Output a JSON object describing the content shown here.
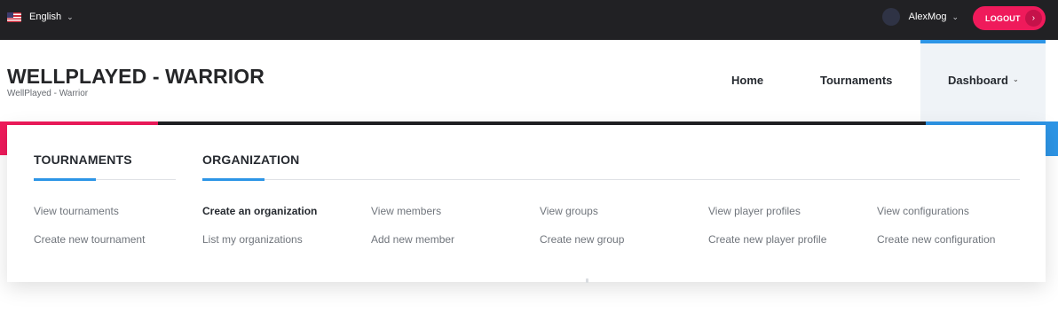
{
  "topbar": {
    "language": "English",
    "username": "AlexMog",
    "logout_label": "LOGOUT"
  },
  "header": {
    "title": "WELLPLAYED - WARRIOR",
    "subtitle": "WellPlayed - Warrior",
    "nav": {
      "home": "Home",
      "tournaments": "Tournaments",
      "dashboard": "Dashboard"
    }
  },
  "mega_menu": {
    "tournaments": {
      "title": "TOURNAMENTS",
      "links": [
        "View tournaments",
        "Create new tournament"
      ]
    },
    "organization": {
      "title": "ORGANIZATION",
      "columns": [
        [
          "Create an organization",
          "List my organizations"
        ],
        [
          "View members",
          "Add new member"
        ],
        [
          "View groups",
          "Create new group"
        ],
        [
          "View player profiles",
          "Create new player profile"
        ],
        [
          "View configurations",
          "Create new configuration"
        ]
      ]
    }
  },
  "colors": {
    "topbar": "#212124",
    "accent_pink": "#ef1a5b",
    "accent_blue": "#2d95e6"
  },
  "icons": [
    "us-flag-icon",
    "chevron-down-icon",
    "avatar",
    "chevron-right-icon"
  ]
}
